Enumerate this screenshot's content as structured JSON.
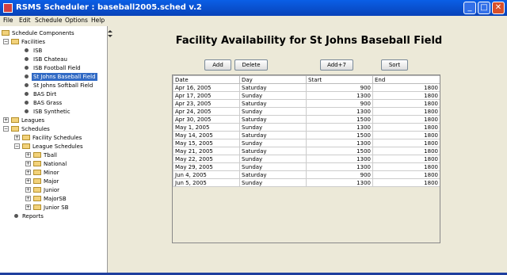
{
  "window": {
    "title": "RSMS Scheduler : baseball2005.sched v.2",
    "minimize": "_",
    "maximize": "□",
    "close": "✕"
  },
  "menu": [
    "File",
    "Edit",
    "Schedule",
    "Options",
    "Help"
  ],
  "tree": {
    "root": "Schedule Components",
    "facilities_label": "Facilities",
    "facilities": [
      "ISB",
      "ISB Chateau",
      "ISB Football Field",
      "St Johns Baseball Field",
      "St Johns Softball Field",
      "BAS Dirt",
      "BAS Grass",
      "ISB Synthetic"
    ],
    "selected_facility": "St Johns Baseball Field",
    "leagues_label": "Leagues",
    "schedules_label": "Schedules",
    "facility_schedules_label": "Facility Schedules",
    "league_schedules_label": "League Schedules",
    "league_schedules": [
      "Tball",
      "National",
      "Minor",
      "Major",
      "Junior",
      "MajorSB",
      "Junior SB"
    ],
    "reports_label": "Reports",
    "expander_open": "−",
    "expander_closed": "+"
  },
  "main": {
    "heading": "Facility Availability for St Johns Baseball Field",
    "buttons": {
      "add": "Add",
      "delete": "Delete",
      "add7": "Add+7",
      "sort": "Sort"
    },
    "columns": [
      "Date",
      "Day",
      "Start",
      "End"
    ],
    "rows": [
      [
        "Apr 16, 2005",
        "Saturday",
        "900",
        "1800"
      ],
      [
        "Apr 17, 2005",
        "Sunday",
        "1300",
        "1800"
      ],
      [
        "Apr 23, 2005",
        "Saturday",
        "900",
        "1800"
      ],
      [
        "Apr 24, 2005",
        "Sunday",
        "1300",
        "1800"
      ],
      [
        "Apr 30, 2005",
        "Saturday",
        "1500",
        "1800"
      ],
      [
        "May 1, 2005",
        "Sunday",
        "1300",
        "1800"
      ],
      [
        "May 14, 2005",
        "Saturday",
        "1500",
        "1800"
      ],
      [
        "May 15, 2005",
        "Sunday",
        "1300",
        "1800"
      ],
      [
        "May 21, 2005",
        "Saturday",
        "1500",
        "1800"
      ],
      [
        "May 22, 2005",
        "Sunday",
        "1300",
        "1800"
      ],
      [
        "May 29, 2005",
        "Sunday",
        "1300",
        "1800"
      ],
      [
        "Jun 4, 2005",
        "Saturday",
        "900",
        "1800"
      ],
      [
        "Jun 5, 2005",
        "Sunday",
        "1300",
        "1800"
      ]
    ]
  }
}
